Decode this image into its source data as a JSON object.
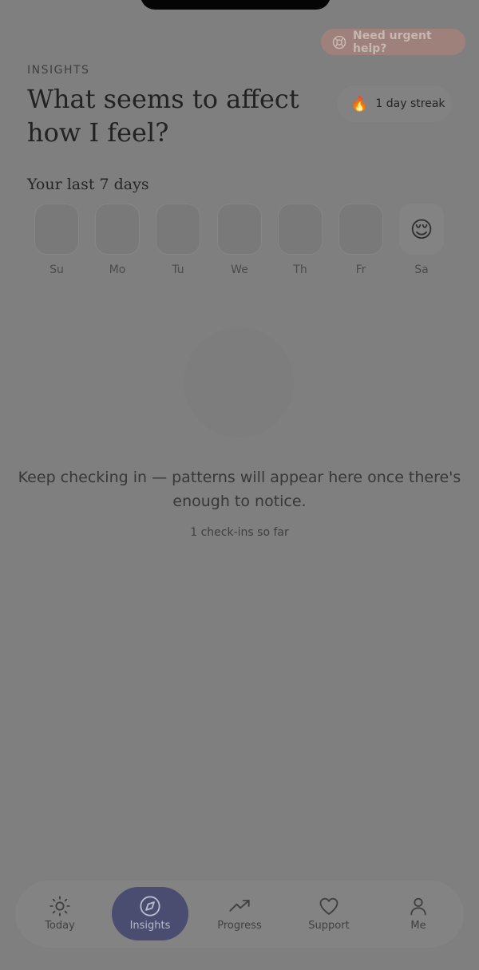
{
  "colors": {
    "accent_active_tab": "#4a4c70",
    "urgent_button": "#9e817a"
  },
  "urgent_help": {
    "icon": "lifebuoy-icon",
    "label": "Need urgent help?"
  },
  "header": {
    "eyebrow": "INSIGHTS",
    "title": "What seems to affect how I feel?"
  },
  "streak": {
    "icon": "fire-icon",
    "emoji": "🔥",
    "label": "1 day streak"
  },
  "week": {
    "label": "Your last 7 days",
    "days": [
      {
        "label": "Su",
        "mood": ""
      },
      {
        "label": "Mo",
        "mood": ""
      },
      {
        "label": "Tu",
        "mood": ""
      },
      {
        "label": "We",
        "mood": ""
      },
      {
        "label": "Th",
        "mood": ""
      },
      {
        "label": "Fr",
        "mood": ""
      },
      {
        "label": "Sa",
        "mood": "😌"
      }
    ]
  },
  "empty_state": {
    "message": "Keep checking in — patterns will appear here once there's enough to notice.",
    "count": "1 check-ins so far"
  },
  "tabs": [
    {
      "label": "Today",
      "icon": "sun-icon",
      "active": false
    },
    {
      "label": "Insights",
      "icon": "compass-icon",
      "active": true
    },
    {
      "label": "Progress",
      "icon": "trending-up-icon",
      "active": false
    },
    {
      "label": "Support",
      "icon": "heart-icon",
      "active": false
    },
    {
      "label": "Me",
      "icon": "person-icon",
      "active": false
    }
  ]
}
